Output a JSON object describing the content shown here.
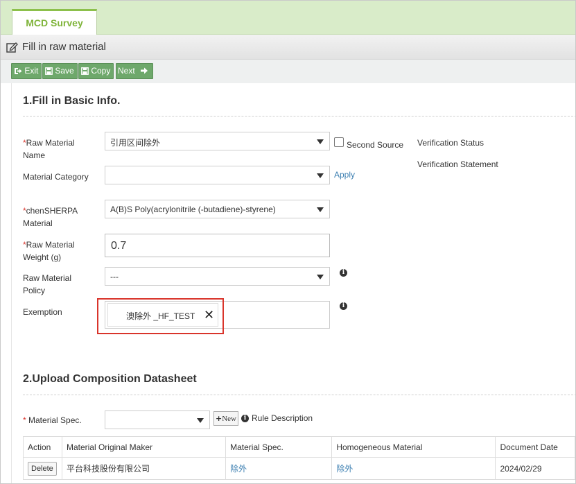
{
  "tab": {
    "label": "MCD Survey"
  },
  "page": {
    "title": "Fill in raw material"
  },
  "toolbar": {
    "exit": "Exit",
    "save": "Save",
    "copy": "Copy",
    "next": "Next"
  },
  "section1": {
    "heading": "1.Fill in Basic Info.",
    "raw_material_name": {
      "star": "*",
      "label": "Raw Material Name",
      "value": "引用区间除外"
    },
    "second_source": {
      "label": "Second Source",
      "checked": false
    },
    "verification_status": "Verification Status",
    "verification_statement": "Verification Statement",
    "material_category": {
      "label": "Material Category",
      "value": ""
    },
    "apply": "Apply",
    "chensherpa": {
      "star": "*",
      "label": "chenSHERPA Material",
      "value": "A(B)S Poly(acrylonitrile (-butadiene)-styrene)"
    },
    "weight": {
      "star": "*",
      "label": "Raw Material Weight (g)",
      "value": "0.7"
    },
    "policy": {
      "label": "Raw Material Policy",
      "value": "---"
    },
    "exemption": {
      "label": "Exemption",
      "tag": "澳除外 _HF_TEST",
      "remove": "✕"
    }
  },
  "section2": {
    "heading": "2.Upload Composition Datasheet",
    "material_spec": {
      "star": "*",
      "label": "Material Spec.",
      "value": ""
    },
    "new_button": "New",
    "rule_description": "Rule Description",
    "table": {
      "headers": [
        "Action",
        "Material Original Maker",
        "Material Spec.",
        "Homogeneous Material",
        "Document Date"
      ],
      "rows": [
        {
          "action": "Delete",
          "maker": "平台科技股份有限公司",
          "spec": "除外",
          "homogeneous": "除外",
          "date": "2024/02/29"
        }
      ]
    }
  },
  "colors": {
    "accent_green": "#7fb43a",
    "button_green": "#6ea86b",
    "link_blue": "#3c7fb1",
    "highlight_red": "#d9342b"
  }
}
